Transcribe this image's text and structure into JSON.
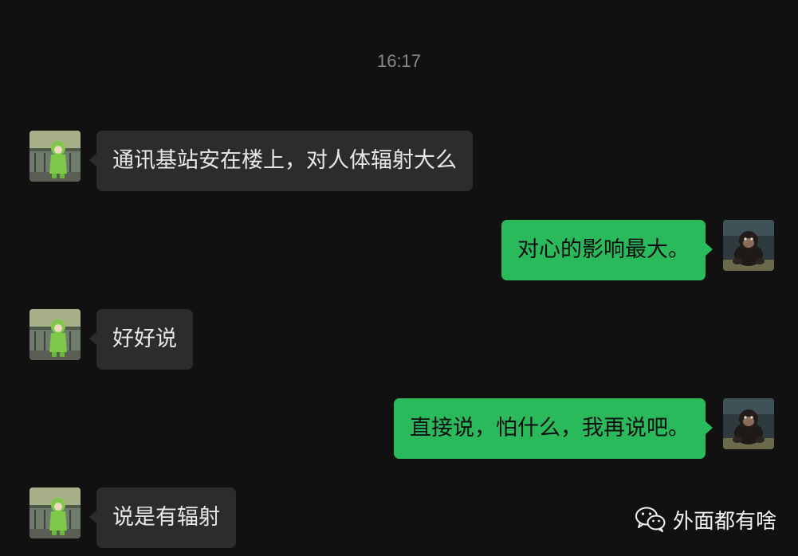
{
  "chat": {
    "timestamp": "16:17",
    "messages": [
      {
        "sender": "contact",
        "avatar": "green-hooded-girl-avatar",
        "text": "通讯基站安在楼上，对人体辐射大么"
      },
      {
        "sender": "self",
        "avatar": "chimpanzee-avatar",
        "text": "对心的影响最大。"
      },
      {
        "sender": "contact",
        "avatar": "green-hooded-girl-avatar",
        "text": "好好说"
      },
      {
        "sender": "self",
        "avatar": "chimpanzee-avatar",
        "text": "直接说，怕什么，我再说吧。"
      },
      {
        "sender": "contact",
        "avatar": "green-hooded-girl-avatar",
        "text": "说是有辐射"
      }
    ]
  },
  "watermark": {
    "icon": "wechat-icon",
    "text": "外面都有啥"
  },
  "colors": {
    "background": "#111111",
    "incoming_bubble": "#2c2c2c",
    "outgoing_bubble": "#2aba5c",
    "timestamp_text": "#8a8a8a"
  }
}
